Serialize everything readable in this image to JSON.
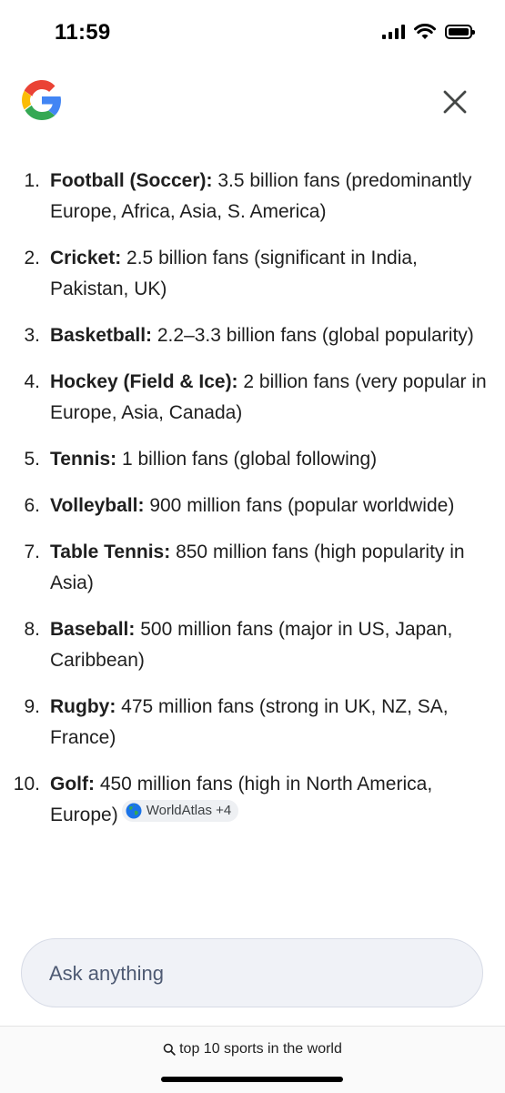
{
  "status_bar": {
    "time": "11:59"
  },
  "header": {
    "logo_icon": "google-g-icon",
    "close_icon": "close-icon"
  },
  "answer": {
    "items": [
      {
        "num": "1.",
        "name": "Football (Soccer):",
        "desc": " 3.5 billion fans (predominantly Europe, Africa, Asia, S. America)"
      },
      {
        "num": "2.",
        "name": "Cricket:",
        "desc": " 2.5 billion fans (significant in India, Pakistan, UK)"
      },
      {
        "num": "3.",
        "name": "Basketball:",
        "desc": " 2.2–3.3 billion fans (global popularity)"
      },
      {
        "num": "4.",
        "name": "Hockey (Field & Ice):",
        "desc": " 2 billion fans (very popular in Europe, Asia, Canada)"
      },
      {
        "num": "5.",
        "name": "Tennis:",
        "desc": " 1 billion fans (global following)"
      },
      {
        "num": "6.",
        "name": "Volleyball:",
        "desc": " 900 million fans (popular worldwide)"
      },
      {
        "num": "7.",
        "name": "Table Tennis:",
        "desc": " 850 million fans (high popularity in Asia)"
      },
      {
        "num": "8.",
        "name": "Baseball:",
        "desc": " 500 million fans (major in US, Japan, Caribbean)"
      },
      {
        "num": "9.",
        "name": "Rugby:",
        "desc": " 475 million fans (strong in UK, NZ, SA, France)"
      },
      {
        "num": "10.",
        "name": "Golf:",
        "desc": " 450 million fans (high in North America, Europe)"
      }
    ],
    "source_chip": {
      "label": "WorldAtlas +4",
      "icon": "globe-icon"
    }
  },
  "ask": {
    "placeholder": "Ask anything"
  },
  "footer": {
    "query": "top 10 sports in the world",
    "query_icon": "search-icon"
  },
  "colors": {
    "google_blue": "#4285F4",
    "google_red": "#EA4335",
    "google_yellow": "#FBBC05",
    "google_green": "#34A853"
  }
}
